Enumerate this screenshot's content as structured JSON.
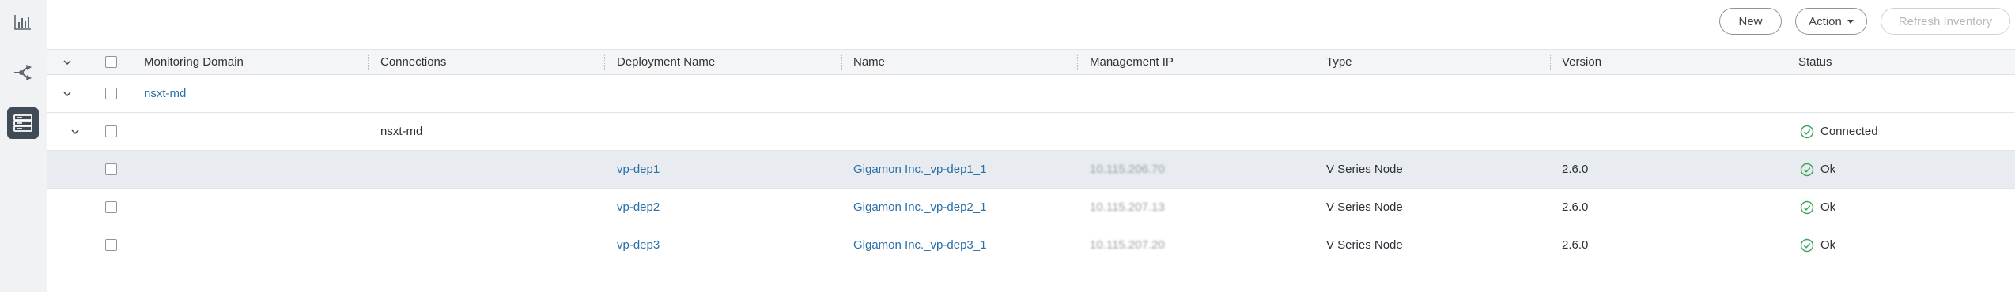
{
  "toolbar": {
    "new_label": "New",
    "action_label": "Action",
    "refresh_label": "Refresh Inventory"
  },
  "sidebar": {
    "items": [
      {
        "icon": "chart-icon",
        "active": false
      },
      {
        "icon": "topology-icon",
        "active": false
      },
      {
        "icon": "inventory-icon",
        "active": true
      }
    ]
  },
  "table": {
    "columns": [
      "Monitoring Domain",
      "Connections",
      "Deployment Name",
      "Name",
      "Management IP",
      "Type",
      "Version",
      "Status"
    ],
    "domain_row": {
      "monitoring_domain": "nsxt-md"
    },
    "connection_row": {
      "connection": "nsxt-md",
      "status": "Connected"
    },
    "rows": [
      {
        "deployment_name": "vp-dep1",
        "name": "Gigamon Inc._vp-dep1_1",
        "management_ip": "10.115.206.70",
        "type": "V Series Node",
        "version": "2.6.0",
        "status": "Ok"
      },
      {
        "deployment_name": "vp-dep2",
        "name": "Gigamon Inc._vp-dep2_1",
        "management_ip": "10.115.207.13",
        "type": "V Series Node",
        "version": "2.6.0",
        "status": "Ok"
      },
      {
        "deployment_name": "vp-dep3",
        "name": "Gigamon Inc._vp-dep3_1",
        "management_ip": "10.115.207.20",
        "type": "V Series Node",
        "version": "2.6.0",
        "status": "Ok"
      }
    ]
  },
  "colors": {
    "accent": "#2a6fa8",
    "ok": "#3aa35b",
    "sidebar_active": "#404b57"
  }
}
